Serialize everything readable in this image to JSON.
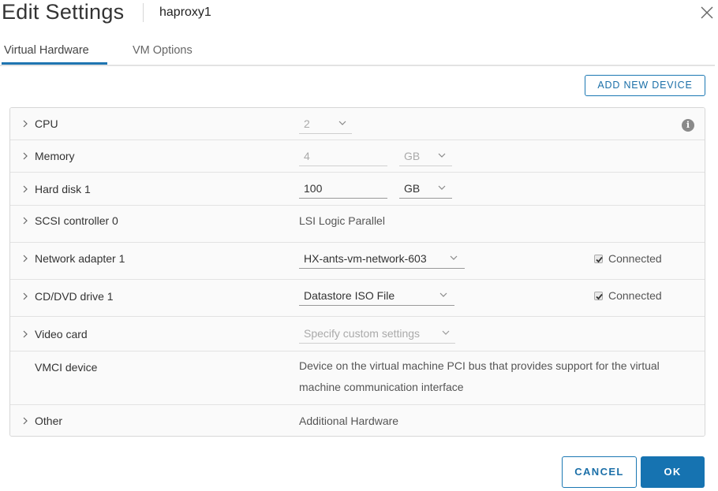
{
  "header": {
    "title": "Edit Settings",
    "vm_name": "haproxy1"
  },
  "tabs": [
    {
      "label": "Virtual Hardware",
      "active": true
    },
    {
      "label": "VM Options",
      "active": false
    }
  ],
  "toolbar": {
    "add_device_label": "ADD NEW DEVICE"
  },
  "hardware": {
    "cpu": {
      "label": "CPU",
      "value": "2",
      "disabled": true
    },
    "memory": {
      "label": "Memory",
      "value": "4",
      "unit": "GB",
      "disabled": true
    },
    "hard_disk": {
      "label": "Hard disk 1",
      "value": "100",
      "unit": "GB"
    },
    "scsi": {
      "label": "SCSI controller 0",
      "value": "LSI Logic Parallel"
    },
    "network": {
      "label": "Network adapter 1",
      "value": "HX-ants-vm-network-603",
      "connected_label": "Connected",
      "connected": true
    },
    "cddvd": {
      "label": "CD/DVD drive 1",
      "value": "Datastore ISO File",
      "connected_label": "Connected",
      "connected": true
    },
    "video": {
      "label": "Video card",
      "value": "Specify custom settings",
      "disabled": true
    },
    "vmci": {
      "label": "VMCI device",
      "description": "Device on the virtual machine PCI bus that provides support for the virtual machine communication interface"
    },
    "other": {
      "label": "Other",
      "value": "Additional Hardware"
    }
  },
  "footer": {
    "cancel_label": "CANCEL",
    "ok_label": "OK"
  },
  "colors": {
    "accent": "#1673b1",
    "tab_underline": "#1f75b1"
  }
}
